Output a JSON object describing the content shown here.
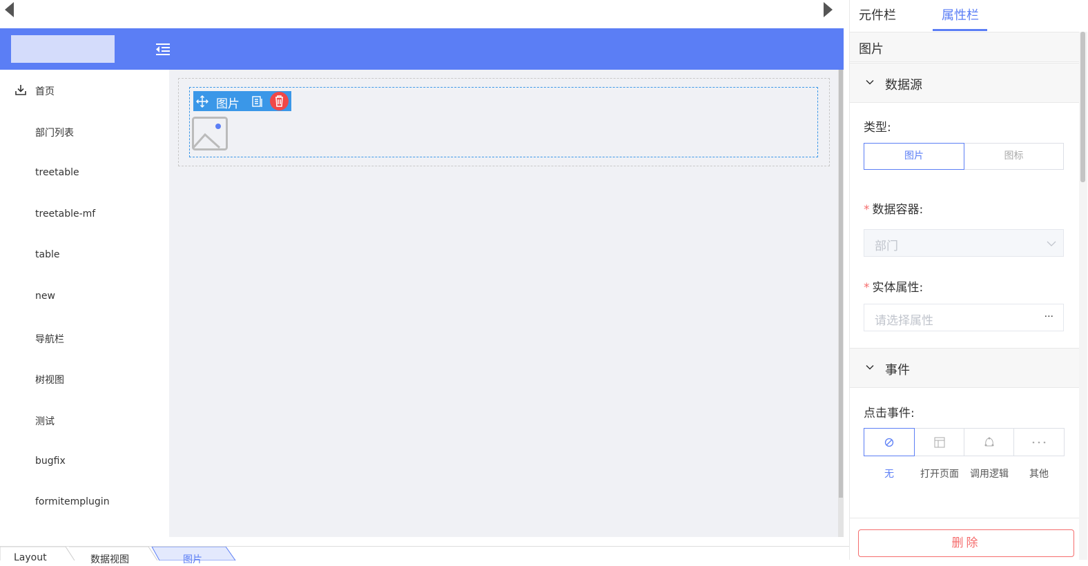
{
  "sidebar": {
    "items": [
      {
        "label": "首页"
      },
      {
        "label": "部门列表"
      },
      {
        "label": "treetable"
      },
      {
        "label": "treetable-mf"
      },
      {
        "label": "table"
      },
      {
        "label": "new"
      },
      {
        "label": "导航栏"
      },
      {
        "label": "树视图"
      },
      {
        "label": "测试"
      },
      {
        "label": "bugfix"
      },
      {
        "label": "formitemplugin"
      }
    ]
  },
  "canvas": {
    "component_toolbar_label": "图片"
  },
  "bottom_tabs": [
    {
      "label": "Layout"
    },
    {
      "label": "数据视图"
    },
    {
      "label": "图片"
    }
  ],
  "right_panel": {
    "tabs": [
      {
        "label": "元件栏"
      },
      {
        "label": "属性栏"
      }
    ],
    "active_tab": "属性栏",
    "component_title": "图片",
    "datasource_section": {
      "title": "数据源",
      "type_label": "类型:",
      "type_options": [
        "图片",
        "图标"
      ],
      "type_selected": "图片",
      "container_label": "数据容器:",
      "container_value": "部门",
      "entity_label": "实体属性:",
      "entity_placeholder": "请选择属性",
      "entity_more": "···"
    },
    "event_section": {
      "title": "事件",
      "click_label": "点击事件:",
      "options": [
        {
          "label": "无",
          "icon": "ban-icon"
        },
        {
          "label": "打开页面",
          "icon": "page-icon"
        },
        {
          "label": "调用逻辑",
          "icon": "logic-icon"
        },
        {
          "label": "其他",
          "icon": "more-icon"
        }
      ],
      "selected": "无"
    },
    "delete_label": "删除"
  },
  "colors": {
    "header": "#5b7ef5",
    "accent": "#5b7ef5",
    "toolbar_blue": "#3a97e8",
    "danger": "#f56c6c"
  }
}
